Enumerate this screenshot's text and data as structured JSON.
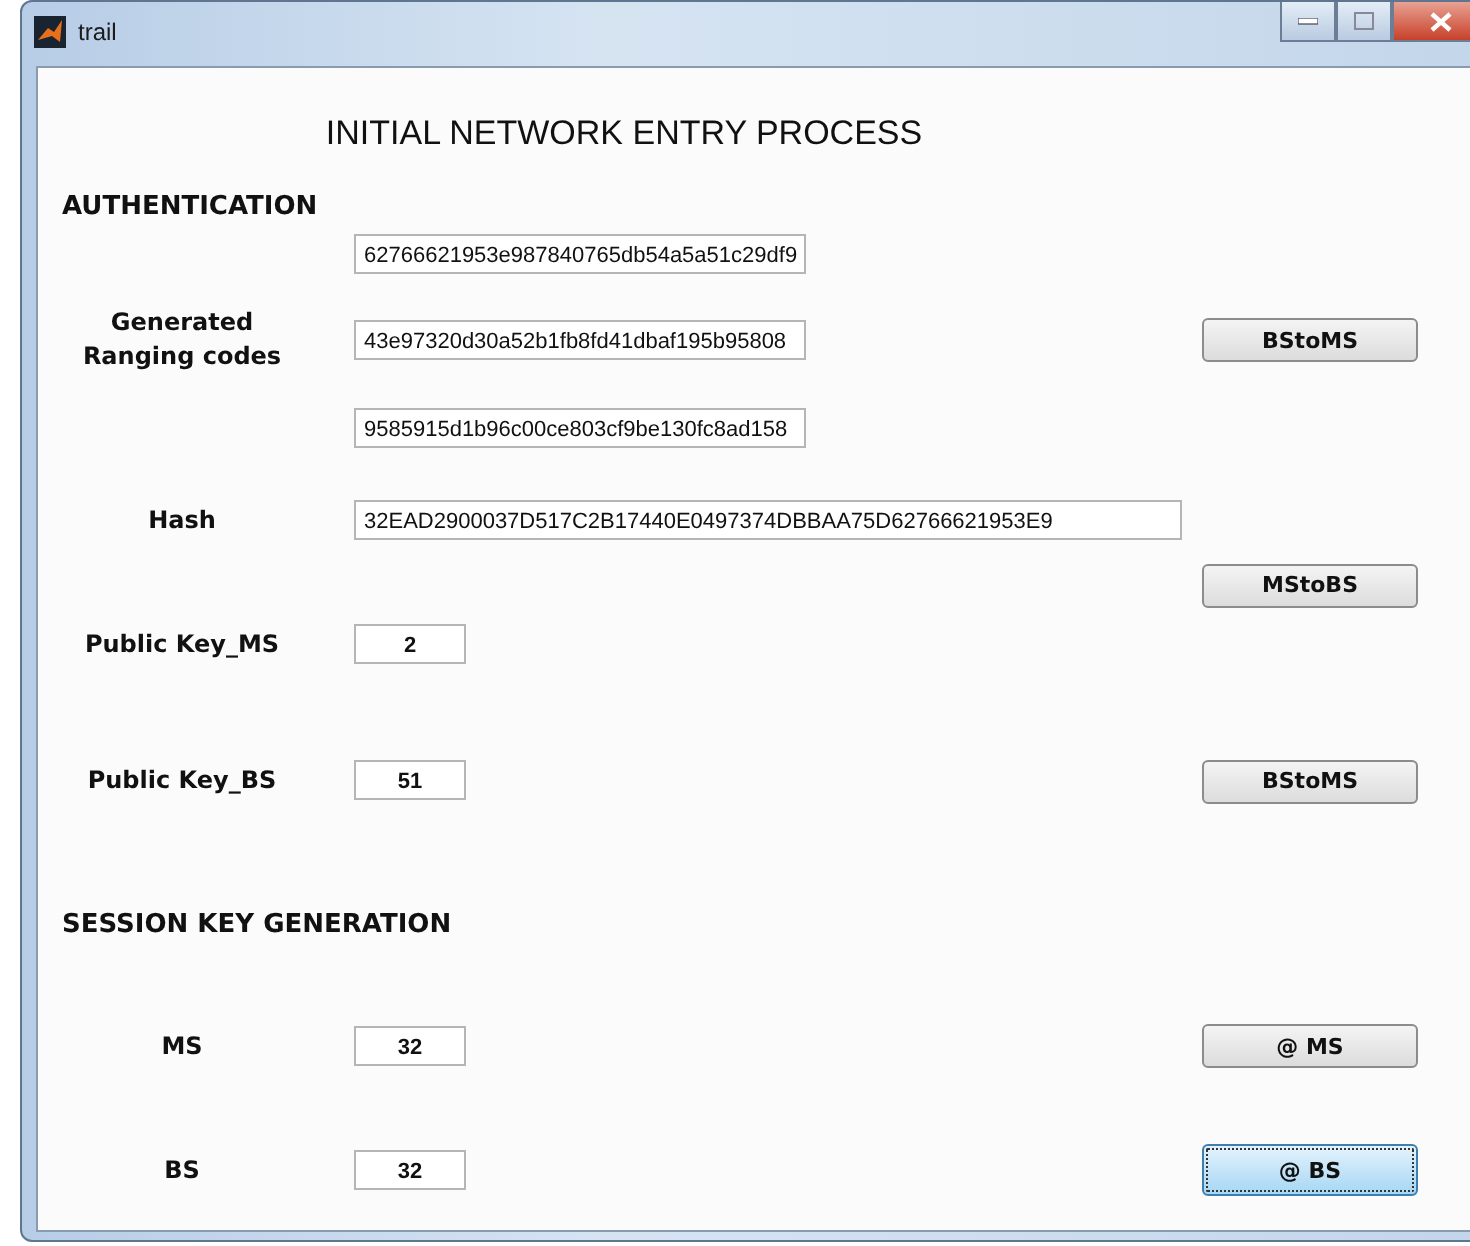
{
  "window": {
    "title": "trail"
  },
  "heading": "INITIAL NETWORK ENTRY PROCESS",
  "sections": [
    {
      "title": "AUTHENTICATION",
      "rows": [
        {
          "field": {
            "kind": "code",
            "value": "62766621953e987840765db54a5a51c29df9"
          }
        },
        {
          "label": "Generated Ranging codes",
          "field": {
            "kind": "code",
            "value": "43e97320d30a52b1fb8fd41dbaf195b95808"
          },
          "button": {
            "label": "BStoMS",
            "focused": false
          }
        },
        {
          "field": {
            "kind": "code",
            "value": "9585915d1b96c00ce803cf9be130fc8ad158"
          }
        },
        {
          "label": "Hash",
          "field": {
            "kind": "hash",
            "value": "32EAD2900037D517C2B17440E0497374DBBAA75D62766621953E9"
          }
        },
        {
          "button": {
            "label": "MStoBS",
            "focused": false
          }
        },
        {
          "label": "Public Key_MS",
          "field": {
            "kind": "number",
            "value": "2"
          }
        },
        {
          "label": "Public Key_BS",
          "field": {
            "kind": "number",
            "value": "51"
          },
          "button": {
            "label": "BStoMS",
            "focused": false
          }
        }
      ]
    },
    {
      "title": "SESSION KEY GENERATION",
      "rows": [
        {
          "label": "MS",
          "field": {
            "kind": "number",
            "value": "32"
          },
          "button": {
            "label": "@ MS",
            "focused": false
          }
        },
        {
          "label": "BS",
          "field": {
            "kind": "number",
            "value": "32"
          },
          "button": {
            "label": "@ BS",
            "focused": true
          }
        }
      ]
    }
  ]
}
